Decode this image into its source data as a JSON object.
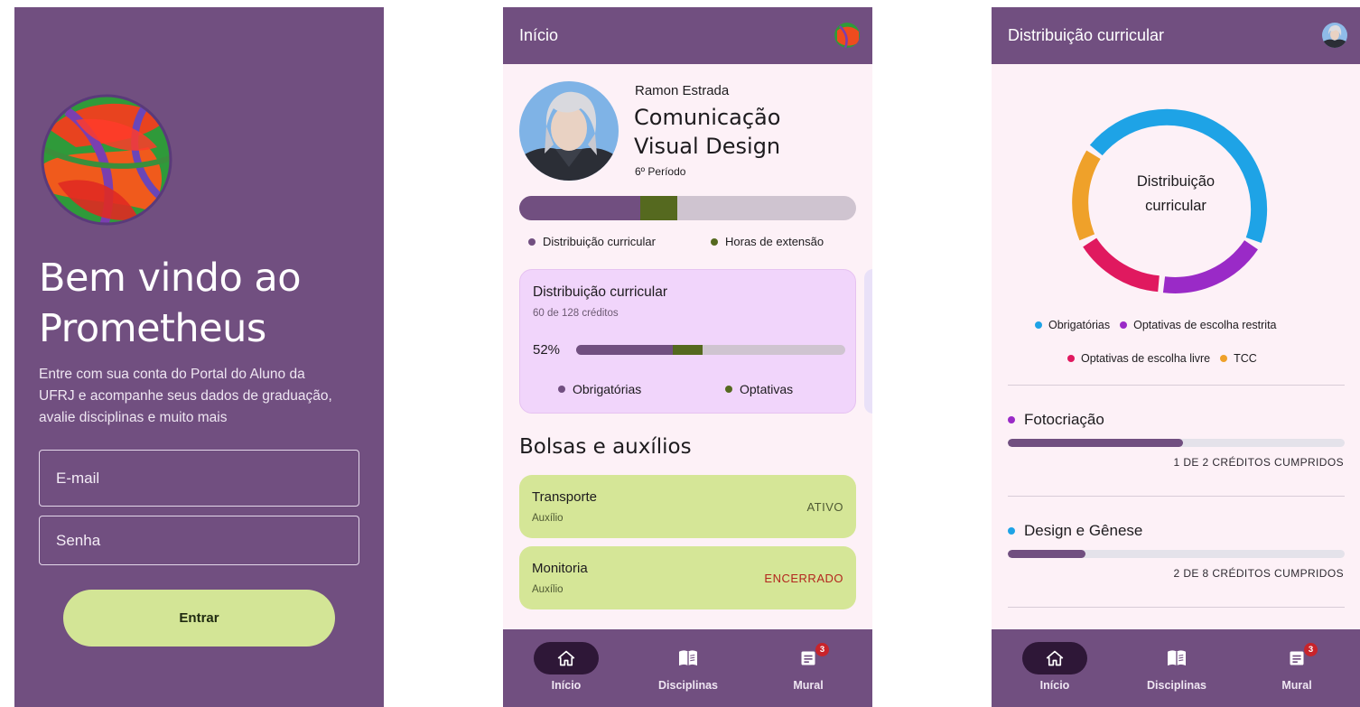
{
  "login": {
    "welcome": "Bem vindo ao Prometheus",
    "description": "Entre com sua conta do Portal do Aluno da UFRJ e acompanhe seus dados de graduação, avalie disciplinas e muito mais",
    "email_placeholder": "E-mail",
    "password_placeholder": "Senha",
    "submit_label": "Entrar"
  },
  "home": {
    "appbar_title": "Início",
    "student_name": "Ramon Estrada",
    "course": "Comunicação Visual Design",
    "period": "6º Período",
    "progress": {
      "curricular_fraction": 0.36,
      "extension_fraction": 0.11
    },
    "legend_curricular": "Distribuição curricular",
    "legend_extension": "Horas de extensão",
    "card": {
      "title": "Distribuição curricular",
      "subtitle": "60 de 128 créditos",
      "percent": "52%",
      "mandatory_fraction": 0.36,
      "optional_fraction": 0.11,
      "legend_mandatory": "Obrigatórias",
      "legend_optional": "Optativas"
    },
    "aids_title": "Bolsas e auxílios",
    "aids": [
      {
        "name": "Transporte",
        "type": "Auxílio",
        "status": "ATIVO",
        "status_color": "#4f5a33"
      },
      {
        "name": "Monitoria",
        "type": "Auxílio",
        "status": "ENCERRADO",
        "status_color": "#b3261e"
      }
    ]
  },
  "nav": {
    "items": [
      {
        "label": "Início",
        "icon": "home-icon"
      },
      {
        "label": "Disciplinas",
        "icon": "book-icon"
      },
      {
        "label": "Mural",
        "icon": "news-icon",
        "badge": "3"
      }
    ]
  },
  "distribution": {
    "appbar_title": "Distribuição curricular",
    "center_label_1": "Distribuição",
    "center_label_2": "curricular",
    "legend": {
      "mandatory": "Obrigatórias",
      "restricted": "Optativas de escolha restrita",
      "free": "Optativas de escolha livre",
      "tcc": "TCC"
    },
    "colors": {
      "mandatory": "#1ea3e6",
      "restricted": "#9a2ac7",
      "free": "#e0195f",
      "tcc": "#efa12a"
    },
    "subjects": [
      {
        "name": "Fotocriação",
        "credits": "1 DE 2 CRÉDITOS CUMPRIDOS",
        "fraction": 0.52,
        "color": "#9a2ac7"
      },
      {
        "name": "Design e Gênese",
        "credits": "2 DE 8 CRÉDITOS CUMPRIDOS",
        "fraction": 0.23,
        "color": "#1ea3e6"
      }
    ]
  }
}
